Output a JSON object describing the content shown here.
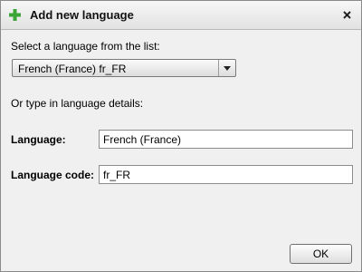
{
  "dialog": {
    "title": "Add new language",
    "title_icon": "plus-icon",
    "close_icon": "close-icon",
    "accent_green": "#3aa635"
  },
  "select_section": {
    "prompt": "Select a language from the list:",
    "selected_value": "French (France)  fr_FR",
    "arrow_icon": "chevron-down-icon"
  },
  "details_section": {
    "prompt": "Or type in language details:",
    "language_label": "Language:",
    "language_value": "French (France)",
    "code_label": "Language code:",
    "code_value": "fr_FR"
  },
  "buttons": {
    "ok_label": "OK"
  }
}
